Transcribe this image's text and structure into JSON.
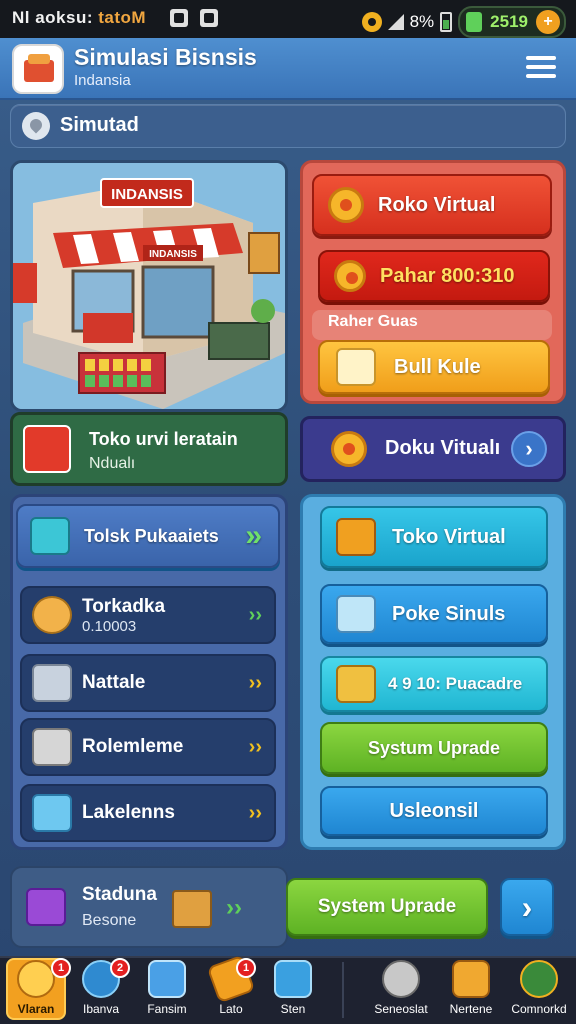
{
  "status_bar": {
    "carrier": "Nl aoksu:",
    "carrier_accent": "tatoM",
    "battery_pct": "8%",
    "coins": "2519",
    "plus": "+"
  },
  "header": {
    "title": "Simulasi Bisnsis",
    "subtitle": "Indansia"
  },
  "breadcrumb": {
    "label": "Simutad"
  },
  "store_image": {
    "sign": "INDANSIS",
    "awning_sign": "INDANSIS"
  },
  "store_note": {
    "title": "Toko urvi leratain",
    "subtitle": "Ndualı"
  },
  "red_panel": {
    "btn_toko": "Roko Virtual",
    "btn_pahar": "Pahar 800:310",
    "section_label": "Raher Guas",
    "btn_bull": "Bull Kule"
  },
  "purple_bar": {
    "label": "Doku Vitualı",
    "arrow": "›"
  },
  "left_panel": {
    "header_label": "Tolsk Pukaaiets",
    "header_arrow": "»",
    "items": [
      {
        "name": "Torkadka",
        "sub": "0.10003"
      },
      {
        "name": "Nattale",
        "sub": ""
      },
      {
        "name": "Rolemleme",
        "sub": ""
      },
      {
        "name": "Lakelenns",
        "sub": ""
      }
    ],
    "arrow_glyphs": "››"
  },
  "right_panel": {
    "buttons": [
      "Toko Virtual",
      "Poke Sinuls",
      "4 9 10: Puacadre",
      "Systum Uprade",
      "Usleonsil"
    ]
  },
  "bottom_card": {
    "title": "Staduna",
    "subtitle": "Besone",
    "arrows": "››"
  },
  "bottom_actions": {
    "upgrade": "System Uprade",
    "next": "›"
  },
  "bottom_nav": {
    "items": [
      {
        "label": "Vlaran",
        "badge": "1"
      },
      {
        "label": "Ibanva",
        "badge": "2"
      },
      {
        "label": "Fansim",
        "badge": ""
      },
      {
        "label": "Lato",
        "badge": "1"
      },
      {
        "label": "Sten",
        "badge": ""
      },
      {
        "label": "Seneoslat",
        "badge": ""
      },
      {
        "label": "Nertene",
        "badge": ""
      },
      {
        "label": "Comnorkd",
        "badge": ""
      }
    ]
  },
  "colors": {
    "accent": "#3a74b8",
    "red": "#e0281c",
    "green": "#5eb224",
    "orange": "#f09e1a",
    "cyan": "#1aa4cc"
  }
}
